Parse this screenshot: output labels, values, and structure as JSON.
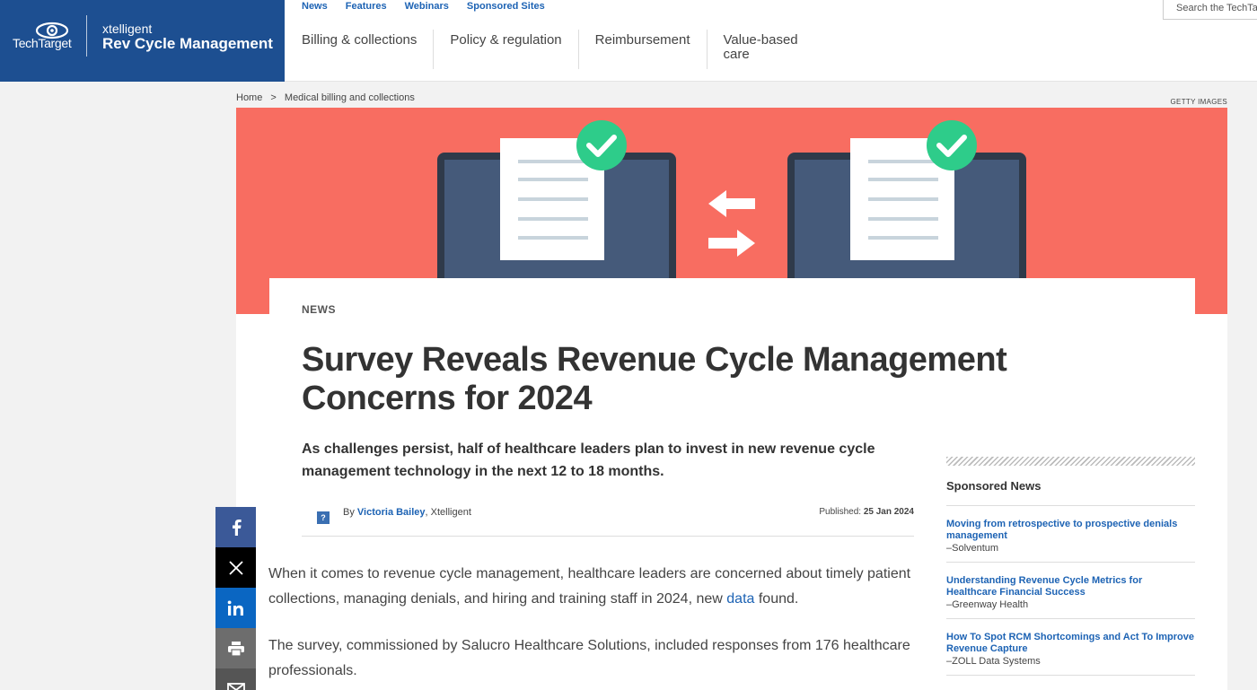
{
  "brand": {
    "company": "TechTarget",
    "xtelligent": "xtelligent",
    "site_name": "Rev Cycle Management",
    "colors": {
      "brand_blue": "#1d4f91",
      "hero_coral": "#f86d61",
      "check_green": "#2ecc8a",
      "link_blue": "#1d63b4"
    }
  },
  "topnav": {
    "items": [
      "News",
      "Features",
      "Webinars",
      "Sponsored Sites"
    ]
  },
  "mainnav": {
    "items": [
      "Billing & collections",
      "Policy & regulation",
      "Reimbursement",
      "Value-based care"
    ]
  },
  "search": {
    "placeholder": "Search the TechTarget"
  },
  "breadcrumb": {
    "home": "Home",
    "separator": ">",
    "section": "Medical billing and collections"
  },
  "hero": {
    "credit": "GETTY IMAGES",
    "icons": [
      "laptop-document-check-icon",
      "swap-arrows-icon",
      "laptop-document-check-icon"
    ]
  },
  "article": {
    "kicker": "NEWS",
    "title": "Survey Reveals Revenue Cycle Management Concerns for 2024",
    "dek": "As challenges persist, half of healthcare leaders plan to invest in new revenue cycle management technology in the next 12 to 18 months.",
    "byline_prefix": "By",
    "author": "Victoria Bailey",
    "author_org": ", Xtelligent",
    "published_label": "Published:",
    "published_date": "25 Jan 2024",
    "p1_before": "When it comes to revenue cycle management, healthcare leaders are concerned about timely patient collections, managing denials, and hiring and training staff in 2024, new ",
    "p1_link": "data",
    "p1_after": " found.",
    "p2": "The survey, commissioned by Salucro Healthcare Solutions, included responses from 176 healthcare professionals."
  },
  "share": {
    "buttons": [
      "facebook-icon",
      "x-icon",
      "linkedin-icon",
      "print-icon",
      "email-icon"
    ]
  },
  "sidebar": {
    "heading": "Sponsored News",
    "items": [
      {
        "title": "Moving from retrospective to prospective denials management",
        "source": "–Solventum"
      },
      {
        "title": "Understanding Revenue Cycle Metrics for Healthcare Financial Success",
        "source": "–Greenway Health"
      },
      {
        "title": "How To Spot RCM Shortcomings and Act To Improve Revenue Capture",
        "source": "–ZOLL Data Systems"
      }
    ]
  }
}
